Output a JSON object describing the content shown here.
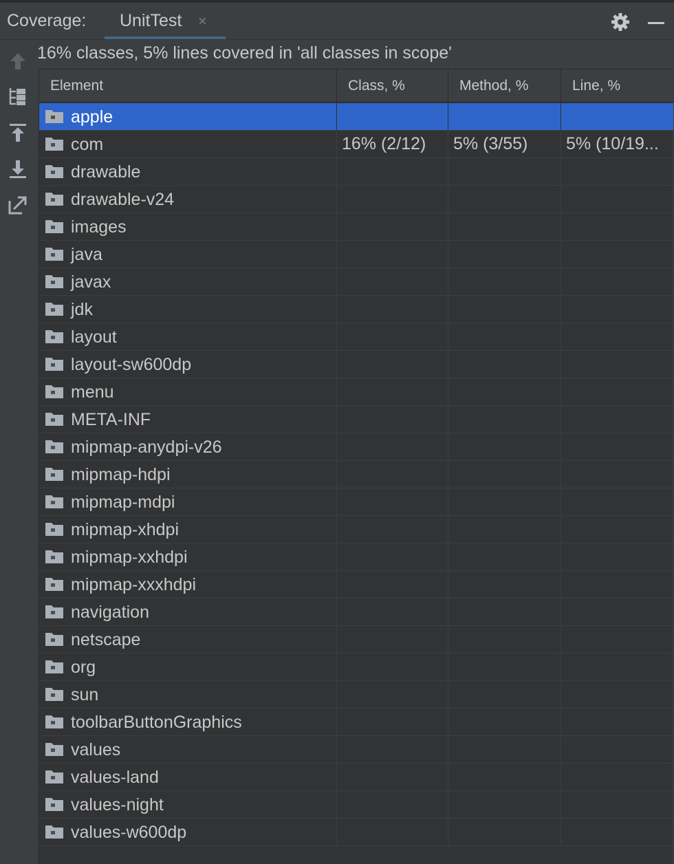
{
  "panel": {
    "title": "Coverage:",
    "tab_label": "UnitTest",
    "tab_close": "×"
  },
  "summary": "16% classes, 5% lines covered in 'all classes in scope'",
  "table": {
    "columns": [
      "Element",
      "Class, %",
      "Method, %",
      "Line, %"
    ],
    "rows": [
      {
        "name": "apple",
        "class": "",
        "method": "",
        "line": "",
        "selected": true
      },
      {
        "name": "com",
        "class": "16% (2/12)",
        "method": "5% (3/55)",
        "line": "5% (10/19..."
      },
      {
        "name": "drawable",
        "class": "",
        "method": "",
        "line": ""
      },
      {
        "name": "drawable-v24",
        "class": "",
        "method": "",
        "line": ""
      },
      {
        "name": "images",
        "class": "",
        "method": "",
        "line": ""
      },
      {
        "name": "java",
        "class": "",
        "method": "",
        "line": ""
      },
      {
        "name": "javax",
        "class": "",
        "method": "",
        "line": ""
      },
      {
        "name": "jdk",
        "class": "",
        "method": "",
        "line": ""
      },
      {
        "name": "layout",
        "class": "",
        "method": "",
        "line": ""
      },
      {
        "name": "layout-sw600dp",
        "class": "",
        "method": "",
        "line": ""
      },
      {
        "name": "menu",
        "class": "",
        "method": "",
        "line": ""
      },
      {
        "name": "META-INF",
        "class": "",
        "method": "",
        "line": ""
      },
      {
        "name": "mipmap-anydpi-v26",
        "class": "",
        "method": "",
        "line": ""
      },
      {
        "name": "mipmap-hdpi",
        "class": "",
        "method": "",
        "line": ""
      },
      {
        "name": "mipmap-mdpi",
        "class": "",
        "method": "",
        "line": ""
      },
      {
        "name": "mipmap-xhdpi",
        "class": "",
        "method": "",
        "line": ""
      },
      {
        "name": "mipmap-xxhdpi",
        "class": "",
        "method": "",
        "line": ""
      },
      {
        "name": "mipmap-xxxhdpi",
        "class": "",
        "method": "",
        "line": ""
      },
      {
        "name": "navigation",
        "class": "",
        "method": "",
        "line": ""
      },
      {
        "name": "netscape",
        "class": "",
        "method": "",
        "line": ""
      },
      {
        "name": "org",
        "class": "",
        "method": "",
        "line": ""
      },
      {
        "name": "sun",
        "class": "",
        "method": "",
        "line": ""
      },
      {
        "name": "toolbarButtonGraphics",
        "class": "",
        "method": "",
        "line": ""
      },
      {
        "name": "values",
        "class": "",
        "method": "",
        "line": ""
      },
      {
        "name": "values-land",
        "class": "",
        "method": "",
        "line": ""
      },
      {
        "name": "values-night",
        "class": "",
        "method": "",
        "line": ""
      },
      {
        "name": "values-w600dp",
        "class": "",
        "method": "",
        "line": ""
      }
    ]
  },
  "toolbar": {
    "icons": [
      "up-arrow-icon",
      "flatten-packages-icon",
      "import-icon",
      "export-icon",
      "generate-report-icon"
    ]
  },
  "colors": {
    "background": "#3c3f41",
    "table_background": "#313335",
    "selection": "#2f65ca",
    "text": "#c8c8c8",
    "folder": "#a9b0b8"
  }
}
